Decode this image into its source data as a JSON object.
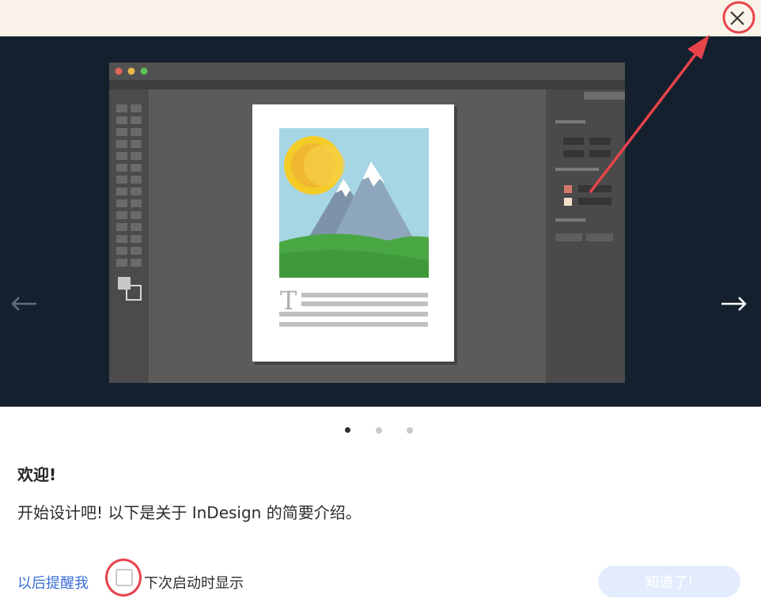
{
  "dialog": {
    "close_icon": "close-icon",
    "welcome_title": "欢迎!",
    "welcome_desc": "开始设计吧! 以下是关于 InDesign 的简要介绍。",
    "remind_later": "以后提醒我",
    "show_next_time": "下次启动时显示",
    "ok_button": "知道了!",
    "checkbox_checked": false
  },
  "carousel": {
    "prev_icon": "arrow-left-icon",
    "next_icon": "arrow-right-icon",
    "slide_count": 3,
    "active_slide": 1
  },
  "illustration": {
    "doc_glyph": "T"
  },
  "colors": {
    "hero_bg": "#14202e",
    "titlebar_bg": "#faf3ea",
    "link": "#3a6fd8",
    "annotation": "#e8434a",
    "button_bg": "#e3ecfc"
  }
}
